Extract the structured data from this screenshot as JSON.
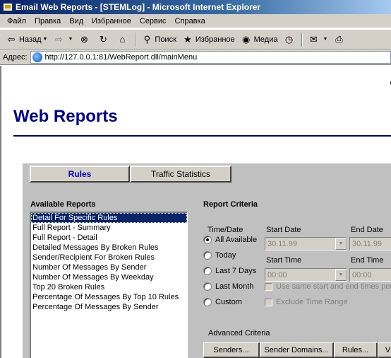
{
  "window": {
    "title": "Email Web Reports - [STEMLog] - Microsoft Internet Explorer"
  },
  "menubar": {
    "items": [
      "Файл",
      "Правка",
      "Вид",
      "Избранное",
      "Сервис",
      "Справка"
    ]
  },
  "toolbar": {
    "back_label": "Назад",
    "search_label": "Поиск",
    "favorites_label": "Избранное",
    "media_label": "Медиа"
  },
  "address": {
    "label": "Адрес:",
    "url": "http://127.0.0.1:81/WebReport.dll/mainMenu"
  },
  "page": {
    "title": "Web Reports",
    "tabs": [
      {
        "label": "Rules",
        "active": true
      },
      {
        "label": "Traffic Statistics",
        "active": false
      }
    ],
    "available_reports": {
      "heading": "Available Reports",
      "items": [
        "Detail For Specific Rules",
        "Full Report - Summary",
        "Full Report - Detail",
        "Detailed Messages By Broken Rules",
        "Sender/Recipient For Broken Rules",
        "Number Of Messages By Sender",
        "Number Of Messages By Weekday",
        "Top 20 Broken Rules",
        "Percentage Of Messages By Top 10 Rules",
        "Percentage Of Messages By Sender"
      ],
      "selected_index": 0
    },
    "criteria": {
      "heading": "Report Criteria",
      "time_date_label": "Time/Date",
      "start_date_label": "Start Date",
      "end_date_label": "End Date",
      "start_time_label": "Start Time",
      "end_time_label": "End Time",
      "options": [
        {
          "label": "All Available",
          "checked": true
        },
        {
          "label": "Today",
          "checked": false
        },
        {
          "label": "Last 7 Days",
          "checked": false
        },
        {
          "label": "Last Month",
          "checked": false
        },
        {
          "label": "Custom",
          "checked": false
        }
      ],
      "start_date_value": "30.11.99",
      "end_date_value": "30.11.99",
      "start_time_value": "00:00",
      "end_time_value": "00:00",
      "same_times_label": "Use same start and end times per",
      "exclude_range_label": "Exclude Time Range",
      "advanced_label": "Advanced Criteria",
      "buttons": {
        "senders": "Senders...",
        "sender_domains": "Sender Domains...",
        "rules": "Rules...",
        "more": "V"
      }
    }
  },
  "colors": {
    "title_blue": "#00008b",
    "active_tab_text": "#0000cc",
    "selection": "#0a246a",
    "panel_gray": "#c0c0c0"
  }
}
